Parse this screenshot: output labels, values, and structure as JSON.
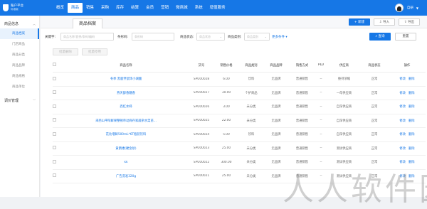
{
  "app": {
    "logo_line1": "账户平台",
    "logo_line2": "标准版"
  },
  "nav": [
    "概览",
    "商品",
    "销售",
    "采购",
    "库存",
    "结算",
    "会员",
    "营销",
    "微商城",
    "系统",
    "增值服务"
  ],
  "nav_active_index": 1,
  "user": {
    "name": "自研"
  },
  "sidebar": {
    "group1": {
      "label": "商品信息",
      "items": [
        "商品档案",
        "门店商品",
        "商品分类",
        "商品品牌",
        "商品规格",
        "商品单位"
      ],
      "active_index": 0
    },
    "group2": {
      "label": "调价管理"
    }
  },
  "page": {
    "title": "商品档案"
  },
  "toolbar": {
    "new_label": "+ 新建",
    "import_label": "导入",
    "export_label": "导出"
  },
  "filters": {
    "keyword_label": "关键字:",
    "keyword_placeholder": "商品名称/首拼/条码/编码",
    "barcode_label": "条形码:",
    "barcode_placeholder": "条形码",
    "status_label": "商品状态:",
    "status_value": "商品状态",
    "category_label": "商品类别:",
    "category_value": "商品类别",
    "more_label": "更多条件 ▾",
    "query_label": "查询",
    "reset_label": "重置"
  },
  "batch": {
    "delete_label": "批量删除",
    "enable_label": "批量停用"
  },
  "table": {
    "columns": [
      "商品名称",
      "货号",
      "销售价格",
      "商品类别",
      "商品品牌",
      "销售方式",
      "PLU",
      "供应商",
      "商品状态",
      "操作"
    ],
    "rows": [
      {
        "name": "冬季 黑鹿伴鼠饰小调酸",
        "code": "SPU00028",
        "price": "6.00",
        "category": "饮料",
        "brand": "无品牌",
        "way": "普通销售",
        "plu": "--",
        "supplier": "维持浓缩",
        "status": "正常"
      },
      {
        "name": "燕天醇香糖香",
        "code": "SPU00027",
        "price": "30.00",
        "category": "个护商品",
        "brand": "无品牌",
        "way": "普通销售",
        "plu": "--",
        "supplier": "一母供应商",
        "status": "正常"
      },
      {
        "name": "西红水柿",
        "code": "SPU00026",
        "price": "3.00",
        "category": "未分类",
        "brand": "无品牌",
        "way": "普通销售",
        "plu": "--",
        "supplier": "自深供应商",
        "status": "正常"
      },
      {
        "name": "采西山平阳鲜果整顿帝动商存家蔬杂水菜苗...",
        "code": "SPU00025",
        "price": "22.00",
        "category": "未分类",
        "brand": "无品牌",
        "way": "普通销售",
        "plu": "--",
        "supplier": "自深供应商",
        "status": "正常"
      },
      {
        "name": "花比增鲜500mL*6T瓶装饮料",
        "code": "SPU00024",
        "price": "5.00",
        "category": "饮料",
        "brand": "无品牌",
        "way": "普通销售",
        "plu": "--",
        "supplier": "自深供应商",
        "status": "正常"
      },
      {
        "name": "黄鹤楼(硬金砂)",
        "code": "SPU00023",
        "price": "25.00",
        "category": "未分类",
        "brand": "无品牌",
        "way": "普通销售",
        "plu": "--",
        "supplier": "测试供应商",
        "status": "正常"
      },
      {
        "name": "kk",
        "code": "SPU00022",
        "price": "300.00",
        "category": "未分类",
        "brand": "无品牌",
        "way": "普通销售",
        "plu": "--",
        "supplier": "测试供应商",
        "status": "正常"
      },
      {
        "name": "广告洗发320g",
        "code": "SPU00021",
        "price": "25.00",
        "category": "未分类",
        "brand": "无品牌",
        "way": "普通销售",
        "plu": "--",
        "supplier": "测试供应商",
        "status": "正常"
      }
    ],
    "op_edit": "修改",
    "op_delete": "删除"
  },
  "watermark": "人人软件园"
}
